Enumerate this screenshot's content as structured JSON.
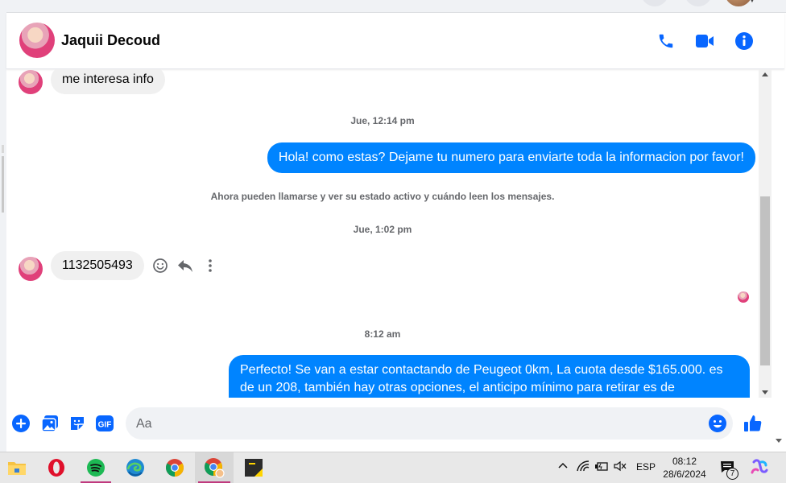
{
  "contact": {
    "name": "Jaquii Decoud"
  },
  "messages": {
    "first_incoming": "me interesa info",
    "ts_1": "Jue, 12:14 pm",
    "outgoing_1": "Hola! como estas? Dejame tu numero para enviarte toda la informacion por favor!",
    "notice": "Ahora pueden llamarse y ver su estado activo y cuándo leen los mensajes.",
    "ts_2": "Jue, 1:02 pm",
    "incoming_2": "1132505493",
    "ts_3": "8:12 am",
    "outgoing_2": "Perfecto!  Se van a estar contactando de Peugeot 0km, La cuota desde $165.000. es de un 208, también hay otras opciones, el anticipo mínimo para retirar es de"
  },
  "composer": {
    "placeholder": "Aa"
  },
  "taskbar": {
    "lang": "ESP",
    "time": "08:12",
    "date": "28/6/2024",
    "notif_count": "7"
  },
  "colors": {
    "accent": "#0084ff",
    "brand_blue": "#0866ff",
    "incoming_bg": "#f0f0f0"
  },
  "icons": {
    "header": [
      "phone-icon",
      "video-camera-icon",
      "info-icon"
    ],
    "composer": [
      "plus-icon",
      "image-icon",
      "sticker-icon",
      "gif-icon",
      "emoji-icon",
      "like-icon"
    ],
    "message_actions": [
      "react-icon",
      "reply-icon",
      "more-icon"
    ],
    "taskbar": [
      "file-explorer-icon",
      "opera-icon",
      "spotify-icon",
      "edge-icon",
      "chrome-icon",
      "chrome-profile-icon",
      "sticky-notes-icon"
    ]
  }
}
